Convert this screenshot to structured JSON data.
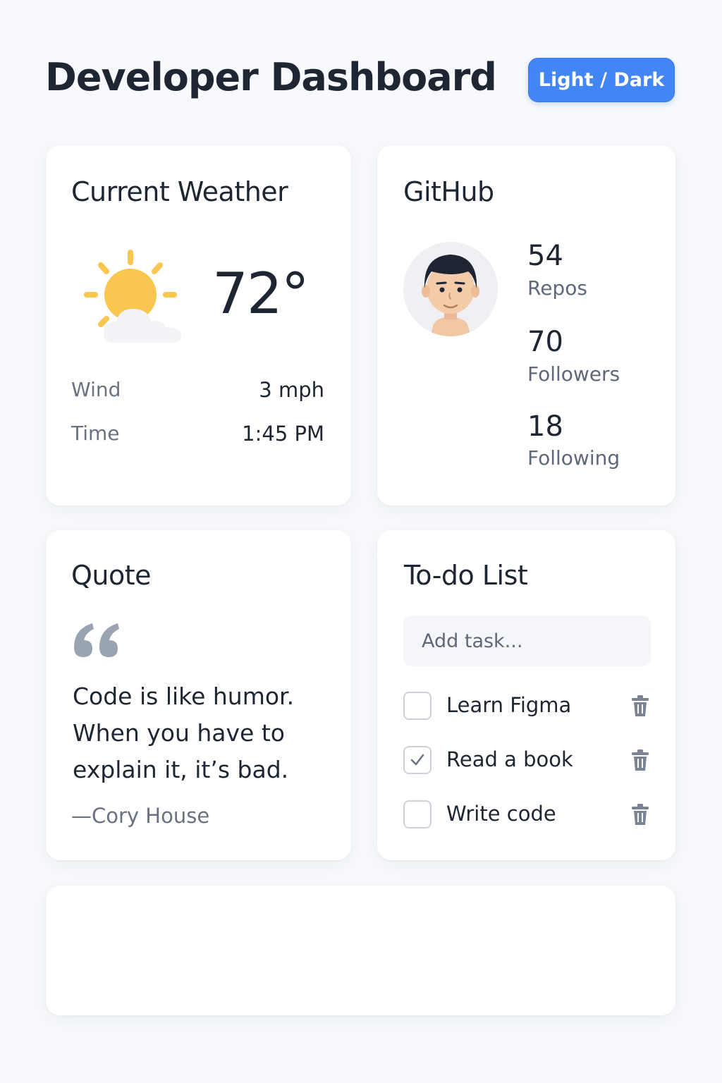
{
  "header": {
    "title": "Developer Dashboard",
    "theme_toggle_label": "Light / Dark"
  },
  "weather": {
    "title": "Current Weather",
    "icon": "partly-sunny-icon",
    "temperature": "72°",
    "rows": [
      {
        "label": "Wind",
        "value": "3 mph"
      },
      {
        "label": "Time",
        "value": "1:45 PM"
      }
    ]
  },
  "github": {
    "title": "GitHub",
    "avatar": "user-avatar-icon",
    "stats": [
      {
        "value": "54",
        "label": "Repos"
      },
      {
        "value": "70",
        "label": "Followers"
      },
      {
        "value": "18",
        "label": "Following"
      }
    ]
  },
  "quote": {
    "title": "Quote",
    "text": "Code is like humor. When you have to explain it, it’s bad.",
    "author": "—Cory House"
  },
  "todo": {
    "title": "To-do List",
    "input_placeholder": "Add task...",
    "items": [
      {
        "label": "Learn Figma",
        "checked": false
      },
      {
        "label": "Read a book",
        "checked": true
      },
      {
        "label": "Write code",
        "checked": false
      }
    ]
  },
  "colors": {
    "accent": "#4285f4",
    "background": "#f7f9fc",
    "card": "#ffffff",
    "sun": "#f9c74f",
    "muted_text": "#6a7282"
  }
}
